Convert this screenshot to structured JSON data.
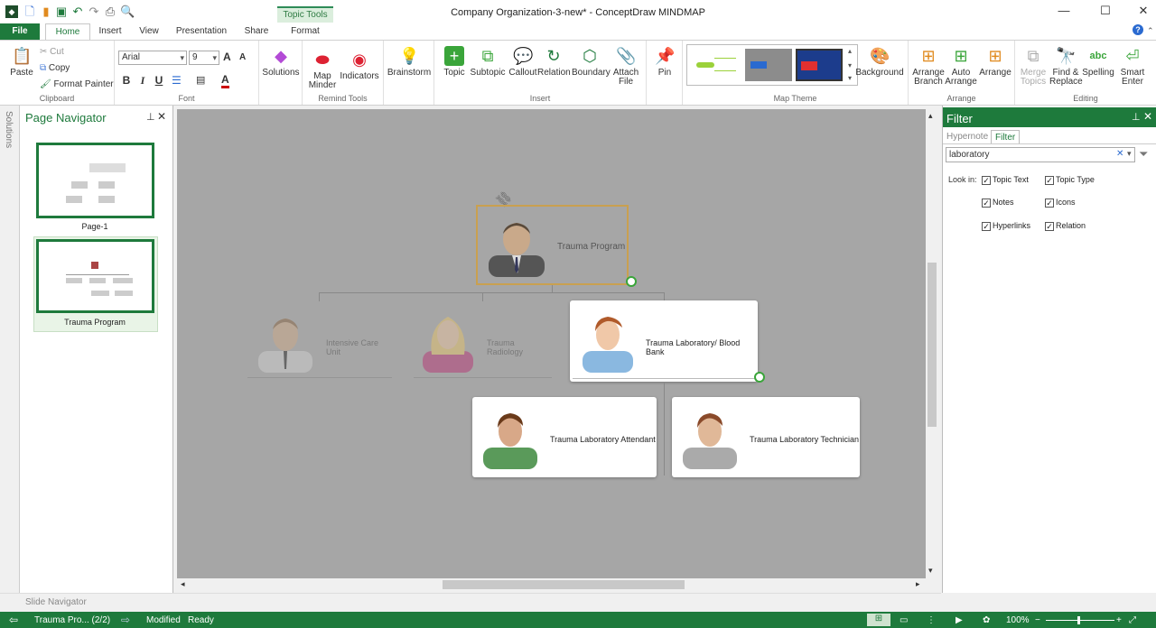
{
  "app": {
    "title": "Company  Organization-3-new* - ConceptDraw MINDMAP",
    "accent": "#1e7a3c"
  },
  "window_buttons": {
    "minimize": "—",
    "maximize": "☐",
    "close": "✕"
  },
  "contextual_tab": "Topic Tools",
  "tabs": [
    "File",
    "Home",
    "Insert",
    "View",
    "Presentation",
    "Share",
    "Format"
  ],
  "ribbon": {
    "clipboard": {
      "label": "Clipboard",
      "paste": "Paste",
      "cut": "Cut",
      "copy": "Copy",
      "format_painter": "Format Painter"
    },
    "font": {
      "label": "Font",
      "family": "Arial",
      "size": "9",
      "bold": "B",
      "italic": "I",
      "underline": "U"
    },
    "solutions": {
      "label": "Solutions"
    },
    "remind": {
      "label": "Remind Tools",
      "map_minder_1": "Map",
      "map_minder_2": "Minder",
      "indicators": "Indicators"
    },
    "brainstorm": {
      "label": "Brainstorm"
    },
    "insert": {
      "label": "Insert",
      "topic": "Topic",
      "subtopic": "Subtopic",
      "callout": "Callout",
      "relation": "Relation",
      "boundary": "Boundary",
      "attach_1": "Attach",
      "attach_2": "File"
    },
    "pin": {
      "label": "Pin"
    },
    "theme": {
      "label": "Map Theme",
      "background": "Background"
    },
    "arrange": {
      "label": "Arrange",
      "branch_1": "Arrange",
      "branch_2": "Branch",
      "auto_1": "Auto",
      "auto_2": "Arrange",
      "arrange": "Arrange"
    },
    "editing": {
      "label": "Editing",
      "merge_1": "Merge",
      "merge_2": "Topics",
      "find_1": "Find &",
      "find_2": "Replace",
      "spelling": "Spelling",
      "smart_1": "Smart",
      "smart_2": "Enter"
    }
  },
  "side_strip": "Solutions",
  "page_navigator": {
    "title": "Page Navigator",
    "pages": [
      "Page-1",
      "Trauma Program"
    ]
  },
  "map": {
    "root": "Trauma Program",
    "children": [
      "Intensive Care Unit",
      "Trauma Radiology",
      "Trauma Laboratory/ Blood Bank"
    ],
    "grandchildren": [
      "Trauma Laboratory Attendant",
      "Trauma Laboratory Technician"
    ]
  },
  "slide_navigator": "Slide Navigator",
  "filter": {
    "title": "Filter",
    "tabs": [
      "Hypernote",
      "Filter"
    ],
    "search_value": "laboratory",
    "look_in": "Look in:",
    "options": [
      {
        "label": "Topic Text",
        "checked": true
      },
      {
        "label": "Topic Type",
        "checked": true
      },
      {
        "label": "Notes",
        "checked": true
      },
      {
        "label": "Icons",
        "checked": true
      },
      {
        "label": "Hyperlinks",
        "checked": true
      },
      {
        "label": "Relation",
        "checked": true
      }
    ]
  },
  "status": {
    "page": "Trauma Pro... (2/2)",
    "modified": "Modified",
    "ready": "Ready",
    "zoom": "100%"
  }
}
